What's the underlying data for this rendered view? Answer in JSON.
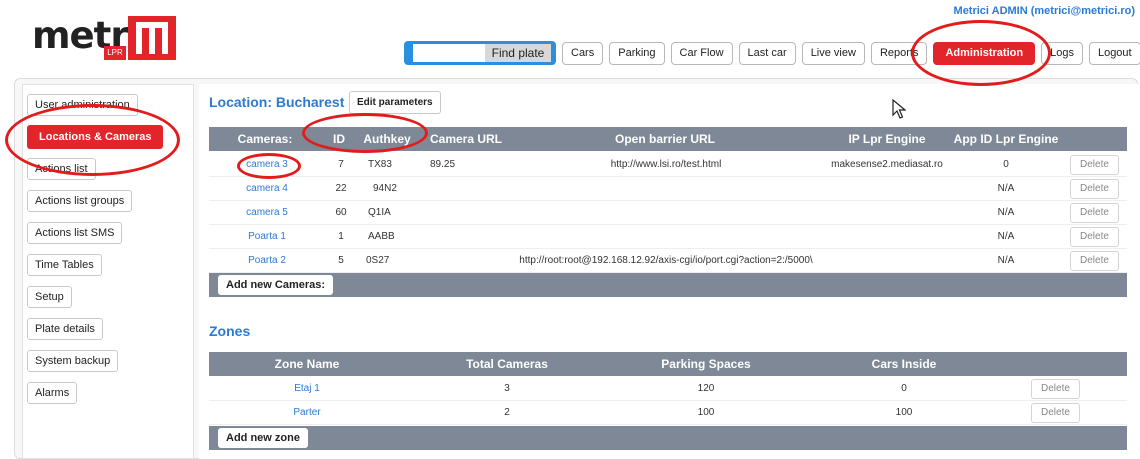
{
  "brand": {
    "logo_text": "metricí",
    "badge": "LPR"
  },
  "header": {
    "user": "Metrici ADMIN (metrici@metrici.ro)"
  },
  "search": {
    "value": "",
    "button": "Find plate"
  },
  "nav": {
    "items": [
      "Cars",
      "Parking",
      "Car Flow",
      "Last car",
      "Live view",
      "Reports",
      "Administration",
      "Logs",
      "Logout"
    ],
    "active": "Administration"
  },
  "sidebar": {
    "items": [
      "User administration",
      "Locations & Cameras",
      "Actions list",
      "Actions list groups",
      "Actions list SMS",
      "Time Tables",
      "Setup",
      "Plate details",
      "System backup",
      "Alarms"
    ],
    "active": "Locations & Cameras"
  },
  "location": {
    "title": "Location: Bucharest",
    "edit_button": "Edit parameters"
  },
  "cameras": {
    "columns": [
      "Cameras:",
      "ID",
      "Authkey",
      "Camera URL",
      "Open barrier URL",
      "IP Lpr Engine",
      "App ID Lpr Engine"
    ],
    "rows": [
      {
        "name": "camera 3",
        "id": "7",
        "authkey": "TX83",
        "camera_url": "89.25",
        "barrier_url": "http://www.lsi.ro/test.html",
        "engine": "makesense2.mediasat.ro",
        "app_id": "0"
      },
      {
        "name": "camera 4",
        "id": "22",
        "authkey": "94N2",
        "camera_url": "",
        "barrier_url": "",
        "engine": "",
        "app_id": "N/A"
      },
      {
        "name": "camera 5",
        "id": "60",
        "authkey": "Q1IA",
        "camera_url": "",
        "barrier_url": "",
        "engine": "",
        "app_id": "N/A"
      },
      {
        "name": "Poarta 1",
        "id": "1",
        "authkey": "AABB",
        "camera_url": "",
        "barrier_url": "",
        "engine": "",
        "app_id": "N/A"
      },
      {
        "name": "Poarta 2",
        "id": "5",
        "authkey": "0S27",
        "camera_url": "",
        "barrier_url": "http://root:root@192.168.12.92/axis-cgi/io/port.cgi?action=2:/5000\\",
        "engine": "",
        "app_id": "N/A"
      }
    ],
    "delete_label": "Delete",
    "add_button": "Add new Cameras:"
  },
  "zones": {
    "title": "Zones",
    "columns": [
      "Zone Name",
      "Total Cameras",
      "Parking Spaces",
      "Cars Inside"
    ],
    "rows": [
      {
        "name": "Etaj 1",
        "cameras": "3",
        "spaces": "120",
        "inside": "0"
      },
      {
        "name": "Parter",
        "cameras": "2",
        "spaces": "100",
        "inside": "100"
      }
    ],
    "delete_label": "Delete",
    "add_button": "Add new zone"
  },
  "colors": {
    "accent": "#e3242b",
    "link": "#2b7bd4",
    "grid_header": "#7e8896",
    "search_bg": "#2a8fe0",
    "annotation": "#e21b1b"
  },
  "icons": {
    "logo": "metrici-m-logo",
    "cursor": "mouse-pointer-icon"
  }
}
